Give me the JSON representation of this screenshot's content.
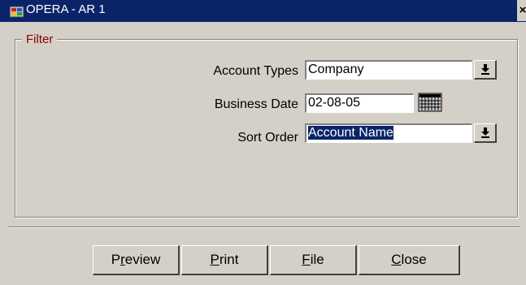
{
  "window": {
    "title": "OPERA - AR 1",
    "close_glyph": "×"
  },
  "filter": {
    "legend": "Filter",
    "account_types": {
      "label": "Account Types",
      "value": "Company",
      "dropdown_glyph": "⬇"
    },
    "business_date": {
      "label": "Business Date",
      "value": "02-08-05"
    },
    "sort_order": {
      "label": "Sort Order",
      "value": "Account Name",
      "dropdown_glyph": "⬇"
    }
  },
  "buttons": {
    "preview": {
      "mnemonic": "r",
      "pre": "P",
      "post": "eview"
    },
    "print": {
      "mnemonic": "P",
      "pre": "",
      "post": "rint"
    },
    "file": {
      "mnemonic": "F",
      "pre": "",
      "post": "ile"
    },
    "close": {
      "mnemonic": "C",
      "pre": "",
      "post": "lose"
    }
  },
  "icons": {
    "app": "opera-app-icon",
    "calendar": "calendar-icon",
    "dropdown": "dropdown-arrow-icon"
  },
  "colors": {
    "titlebar": "#0a246a",
    "legend": "#8b0000",
    "selection": "#0a246a",
    "face": "#d4d0c8"
  }
}
